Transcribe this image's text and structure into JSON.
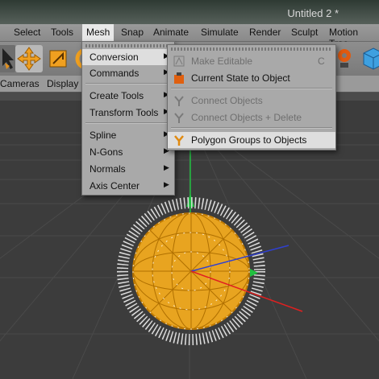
{
  "window": {
    "title": "Untitled 2 *"
  },
  "menubar": {
    "items": [
      "Select",
      "Tools",
      "Mesh",
      "Snap",
      "Animate",
      "Simulate",
      "Render",
      "Sculpt",
      "Motion Trac"
    ]
  },
  "panel": {
    "cameras": "Cameras",
    "display": "Display"
  },
  "mesh_menu": {
    "items": [
      {
        "label": "Conversion",
        "submenu": true
      },
      {
        "label": "Commands",
        "submenu": true
      },
      {
        "label": "Create Tools",
        "submenu": true
      },
      {
        "label": "Transform Tools",
        "submenu": true
      },
      {
        "label": "Spline",
        "submenu": true
      },
      {
        "label": "N-Gons",
        "submenu": true
      },
      {
        "label": "Normals",
        "submenu": true
      },
      {
        "label": "Axis Center",
        "submenu": true
      }
    ]
  },
  "conversion_menu": {
    "items": [
      {
        "label": "Make Editable",
        "shortcut": "C",
        "enabled": false,
        "icon": "make-editable-icon"
      },
      {
        "label": "Current State to Object",
        "enabled": true,
        "icon": "current-state-icon"
      },
      {
        "label": "Connect Objects",
        "enabled": false,
        "icon": "connect-objects-icon"
      },
      {
        "label": "Connect Objects + Delete",
        "enabled": false,
        "icon": "connect-delete-icon"
      },
      {
        "label": "Polygon Groups to Objects",
        "enabled": true,
        "highlighted": true,
        "icon": "polygon-groups-icon"
      }
    ]
  },
  "colors": {
    "accent_orange": "#f0a020",
    "menu_bg": "#a9a9a9",
    "highlight": "#dedede",
    "viewport_bg": "#3c3c3c"
  }
}
